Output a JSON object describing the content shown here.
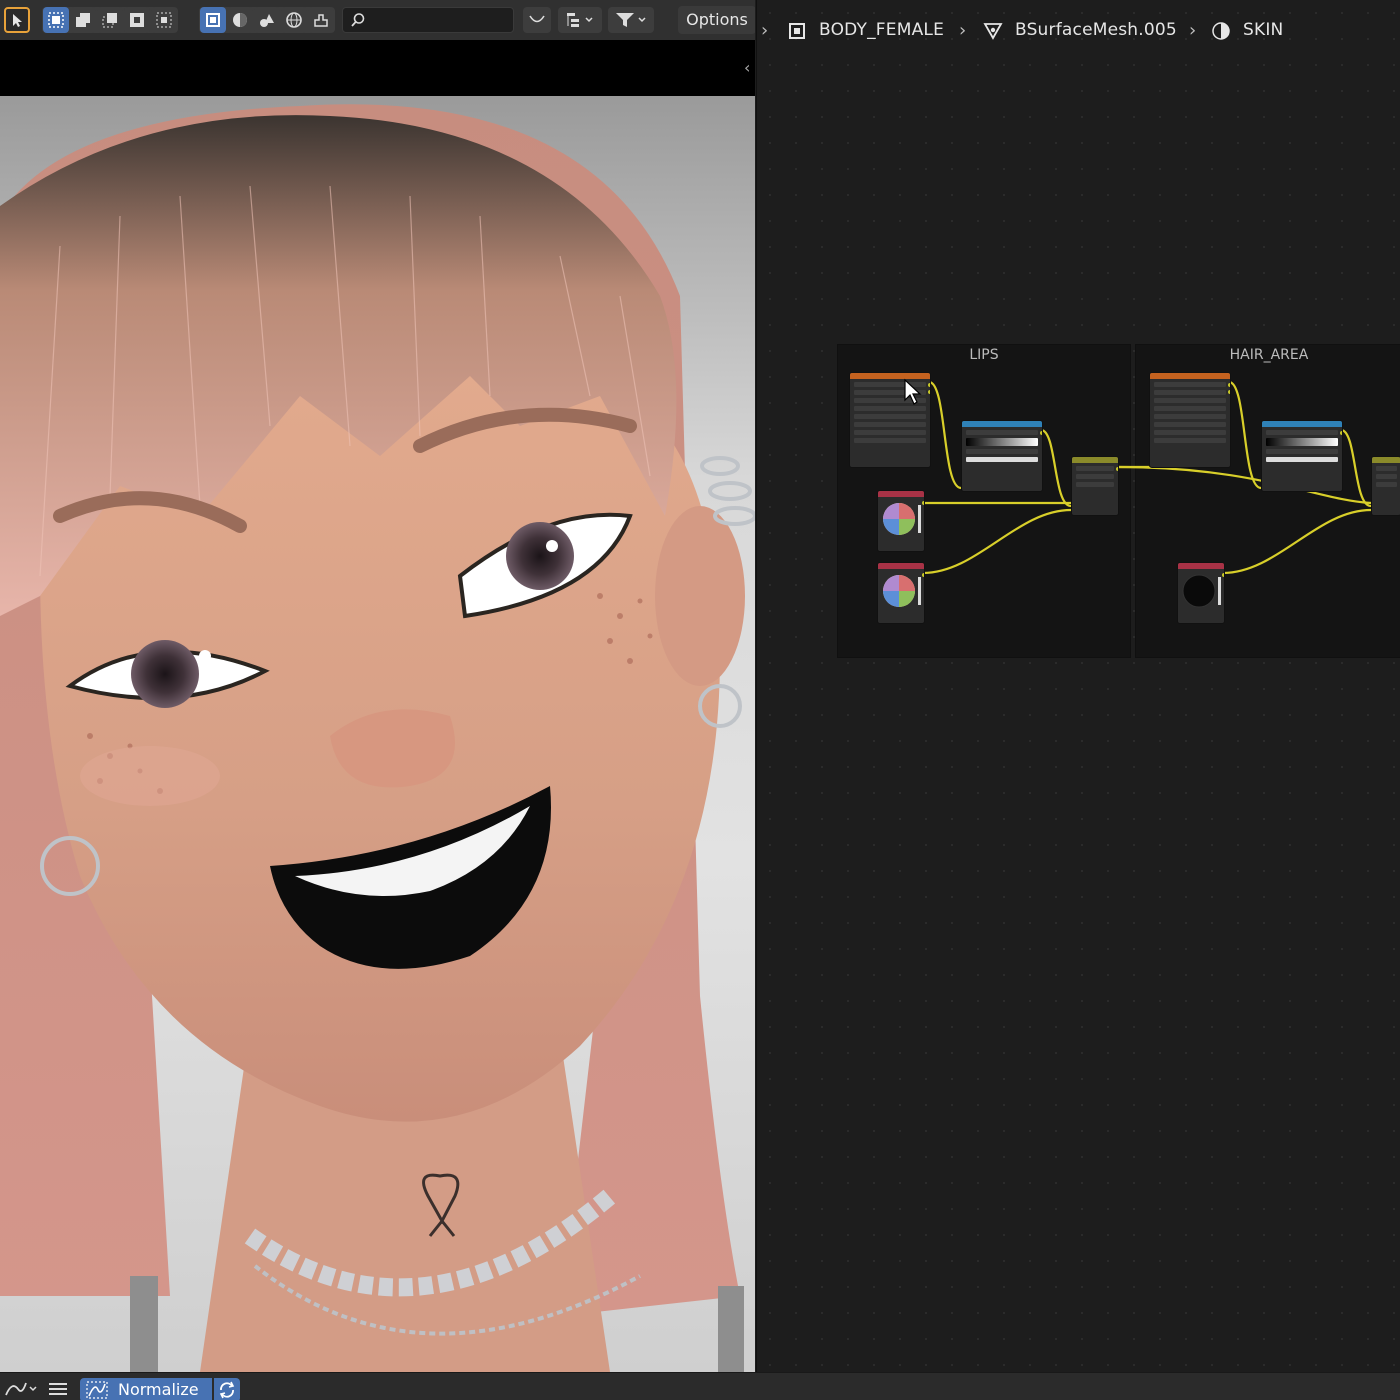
{
  "viewport": {
    "toolbar": {
      "search_value": "",
      "options_label": "Options"
    }
  },
  "node_editor": {
    "breadcrumb": {
      "object": "BODY_FEMALE",
      "mesh": "BSurfaceMesh.005",
      "material": "SKIN"
    },
    "frames": [
      {
        "label": "LIPS"
      },
      {
        "label": "HAIR_AREA"
      }
    ]
  },
  "statusbar": {
    "normalize_label": "Normalize"
  },
  "colors": {
    "accent_blue": "#4772b3",
    "active_tool_outline": "#e8a23a",
    "node_link": "#d8cf2a",
    "image_node_header": "#c4621f",
    "color_ramp_header": "#2f82b8",
    "mix_node_header": "#8a8a2a",
    "rgb_node_header": "#a83246"
  }
}
